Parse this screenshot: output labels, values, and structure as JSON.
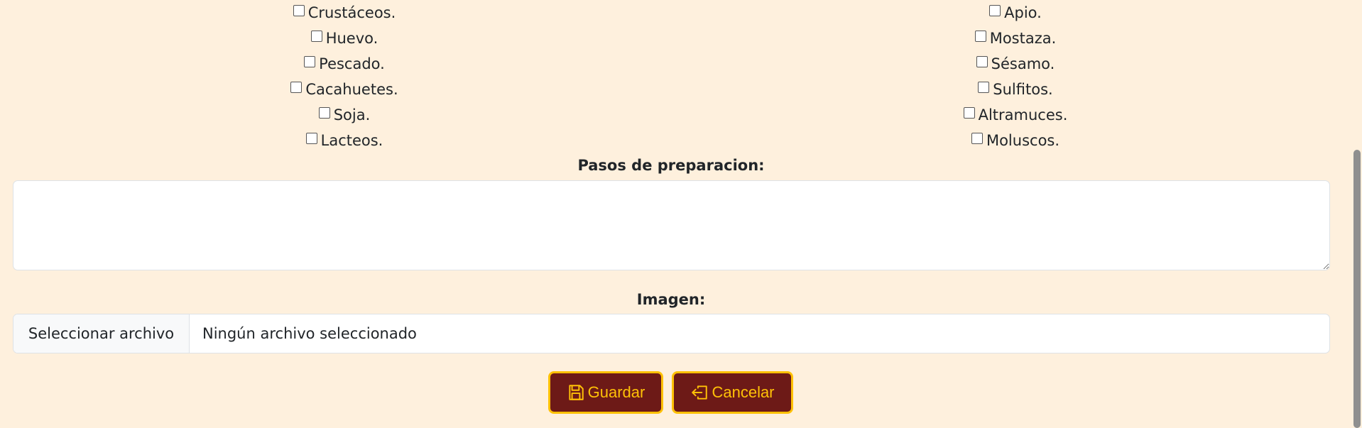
{
  "allergens": {
    "left": [
      {
        "label": "Crustáceos."
      },
      {
        "label": "Huevo."
      },
      {
        "label": "Pescado."
      },
      {
        "label": "Cacahuetes."
      },
      {
        "label": "Soja."
      },
      {
        "label": "Lacteos."
      }
    ],
    "right": [
      {
        "label": "Apio."
      },
      {
        "label": "Mostaza."
      },
      {
        "label": "Sésamo."
      },
      {
        "label": "Sulfitos."
      },
      {
        "label": "Altramuces."
      },
      {
        "label": "Moluscos."
      }
    ]
  },
  "steps": {
    "label": "Pasos de preparacion:",
    "value": ""
  },
  "image": {
    "label": "Imagen:",
    "button_label": "Seleccionar archivo",
    "file_status": "Ningún archivo seleccionado"
  },
  "actions": {
    "save_label": "Guardar",
    "save_icon": "floppy-disk-icon",
    "cancel_label": "Cancelar",
    "cancel_icon": "exit-icon"
  },
  "colors": {
    "background": "#fef0dd",
    "button_bg": "#6d1a17",
    "button_accent": "#ffc107"
  }
}
